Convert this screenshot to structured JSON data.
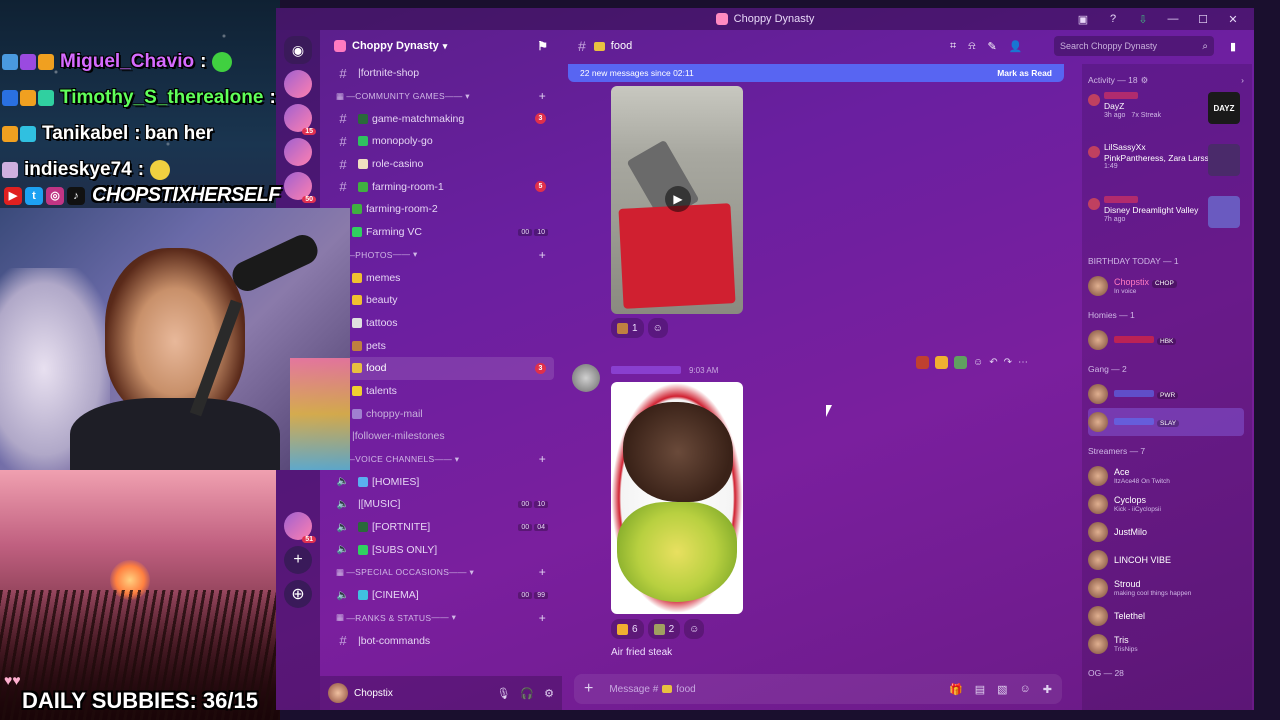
{
  "stream": {
    "chat": [
      {
        "user": "Miguel_Chavio",
        "separator": ":",
        "color": "#d66bff"
      },
      {
        "user": "Timothy_S_therealone",
        "separator": ":",
        "color": "#60ff5a"
      },
      {
        "user": "Tanikabel",
        "separator": ":",
        "message": "ban her",
        "color": "#ffffff"
      },
      {
        "user": "indieskye74",
        "separator": ":",
        "color": "#ffffff"
      }
    ],
    "handle": "CHOPSTIXHERSELF",
    "daily_subbies": "DAILY SUBBIES: 36/15"
  },
  "window": {
    "title": "Choppy Dynasty"
  },
  "guilds": [
    {
      "badge": "15"
    },
    {
      "badge": "50"
    },
    {
      "badge": "51"
    }
  ],
  "server": {
    "name": "Choppy Dynasty",
    "channels": [
      {
        "type": "channel",
        "name": "fortnite-shop",
        "icon": "hash"
      },
      {
        "type": "category",
        "name": "COMMUNITY GAMES"
      },
      {
        "type": "channel",
        "name": "game-matchmaking",
        "icon": "hash",
        "emoji_color": "#2a6a3a",
        "unread": "3"
      },
      {
        "type": "channel",
        "name": "monopoly-go",
        "icon": "hash",
        "emoji_color": "#30c060"
      },
      {
        "type": "channel",
        "name": "role-casino",
        "icon": "hash",
        "emoji_color": "#f0e0c0"
      },
      {
        "type": "channel",
        "name": "farming-room-1",
        "icon": "hash",
        "emoji_color": "#40b040",
        "unread": "5"
      },
      {
        "type": "subchannel",
        "name": "farming-room-2",
        "emoji_color": "#40b040"
      },
      {
        "type": "subchannel",
        "name": "Farming VC",
        "emoji_color": "#30d060",
        "voice": [
          "00",
          "10"
        ]
      },
      {
        "type": "category",
        "name": "PHOTOS"
      },
      {
        "type": "subchannel",
        "name": "memes",
        "emoji_color": "#f0c030"
      },
      {
        "type": "subchannel",
        "name": "beauty",
        "emoji_color": "#f0c030"
      },
      {
        "type": "subchannel",
        "name": "tattoos",
        "emoji_color": "#e0e0e0"
      },
      {
        "type": "subchannel",
        "name": "pets",
        "emoji_color": "#c08040"
      },
      {
        "type": "subchannel",
        "name": "food",
        "emoji_color": "#e8c040",
        "unread": "3",
        "active": true
      },
      {
        "type": "subchannel",
        "name": "talents",
        "emoji_color": "#f0d030"
      },
      {
        "type": "subchannel",
        "name": "choppy-mail",
        "emoji_color": "#a080d0",
        "muted": true
      },
      {
        "type": "subchannel",
        "name": "follower-milestones",
        "muted": true
      },
      {
        "type": "category",
        "name": "VOICE CHANNELS"
      },
      {
        "type": "voice",
        "name": "[HOMIES]",
        "emoji_color": "#5ab0f0"
      },
      {
        "type": "voice",
        "name": "[MUSIC]",
        "voice": [
          "00",
          "10"
        ]
      },
      {
        "type": "voice",
        "name": "[FORTNITE]",
        "emoji_color": "#2a6a3a",
        "voice": [
          "00",
          "04"
        ]
      },
      {
        "type": "voice",
        "name": "[SUBS ONLY]",
        "emoji_color": "#30d060"
      },
      {
        "type": "category",
        "name": "SPECIAL OCCASIONS"
      },
      {
        "type": "voice",
        "name": "[CINEMA]",
        "emoji_color": "#40c0e0",
        "voice": [
          "00",
          "99"
        ]
      },
      {
        "type": "category",
        "name": "RANKS & STATUS"
      },
      {
        "type": "channel",
        "name": "bot-commands",
        "icon": "hash"
      }
    ]
  },
  "user_panel": {
    "name": "Chopstix"
  },
  "chat": {
    "channel_name": "food",
    "new_messages": "22 new messages since 02:11",
    "mark_as_read": "Mark as Read",
    "msg1_reactions": [
      {
        "count": "1",
        "color": "#c08040"
      }
    ],
    "msg2_time": "9:03 AM",
    "msg2_reactions": [
      {
        "count": "6",
        "color": "#f0b030"
      },
      {
        "count": "2",
        "color": "#a0a060"
      }
    ],
    "msg2_text": "Air fried steak",
    "composer_placeholder": "Message #",
    "composer_channel": "food",
    "search_placeholder": "Search Choppy Dynasty"
  },
  "members": {
    "activity_title": "Activity — 18",
    "activities": [
      {
        "game": "DayZ",
        "detail": "3h ago",
        "streak": "7x Streak",
        "art": "DAYZ",
        "art_color": "#1a1a1a"
      },
      {
        "user": "LilSassyXx",
        "game": "PinkPantheress, Zara Larss...",
        "detail": "1:49",
        "art_color": "#4a2a6a"
      },
      {
        "game": "Disney Dreamlight Valley",
        "detail": "7h ago",
        "art_color": "#6a5ac0"
      }
    ],
    "sections": [
      {
        "title": "BIRTHDAY TODAY — 1",
        "members": [
          {
            "name": "Chopstix",
            "tag": "CHOP",
            "sub": "In voice",
            "color": "#ff7ac0"
          }
        ]
      },
      {
        "title": "Homies — 1",
        "members": [
          {
            "tag": "HBK",
            "color": "#ff2a2a"
          }
        ]
      },
      {
        "title": "Gang — 2",
        "members": [
          {
            "tag": "PWR",
            "color": "#5a7aff"
          },
          {
            "tag": "SLAY",
            "color": "#5a7aff",
            "highlight": true
          }
        ]
      },
      {
        "title": "Streamers — 7",
        "members": [
          {
            "name": "Ace",
            "sub": "ItzAce48 On Twitch",
            "color": "#ffffff"
          },
          {
            "name": "Cyclops",
            "sub": "Kick - iiCyclopsii",
            "color": "#ffffff"
          },
          {
            "name": "JustMilo",
            "color": "#ffffff"
          },
          {
            "name": "LINCOH VIBE",
            "color": "#ffffff"
          },
          {
            "name": "Stroud",
            "sub": "making cool things happen",
            "color": "#ffffff"
          },
          {
            "name": "Telethel",
            "color": "#ffffff"
          },
          {
            "name": "Tris",
            "sub": "TrisNips",
            "color": "#ffffff"
          }
        ]
      },
      {
        "title": "OG — 28",
        "members": []
      }
    ]
  }
}
